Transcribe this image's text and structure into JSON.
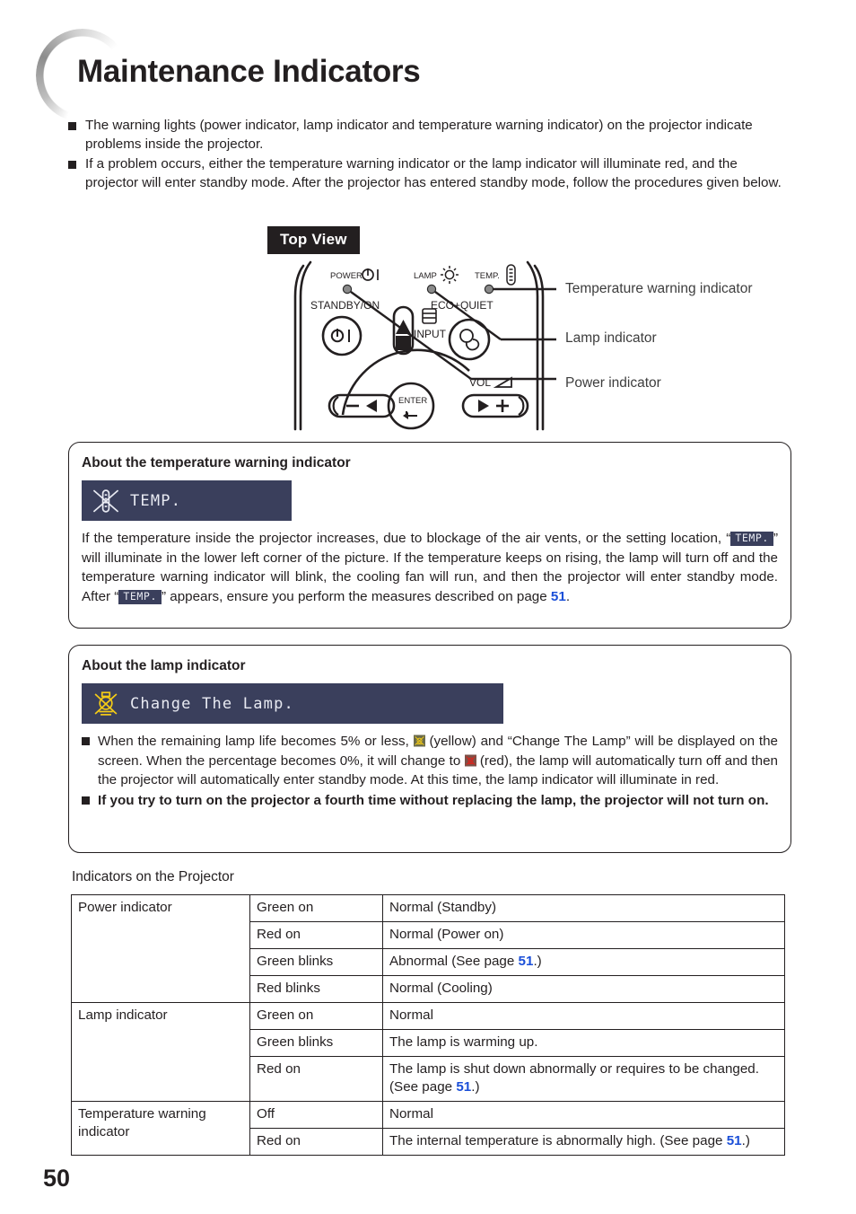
{
  "header": {
    "title": "Maintenance Indicators",
    "decoration_icon": "circle-ring-decoration"
  },
  "intro": {
    "bullets": [
      "The warning lights (power indicator, lamp indicator and temperature warning indicator) on the projector indicate problems inside the projector.",
      "If a problem occurs, either the temperature warning indicator or the lamp indicator will illuminate red, and the projector will enter standby mode. After the projector has entered standby mode, follow the procedures given below."
    ]
  },
  "diagram": {
    "label": "Top View",
    "control_labels": {
      "power": "POWER",
      "lamp": "LAMP",
      "temp": "TEMP.",
      "standby_on": "STANDBY/ON",
      "eco_quiet": "ECO+QUIET",
      "input": "INPUT",
      "vol": "VOL",
      "enter": "ENTER",
      "minus": "−",
      "plus": "+"
    },
    "callouts": [
      "Temperature warning indicator",
      "Lamp indicator",
      "Power indicator"
    ]
  },
  "temp_section": {
    "heading": "About the temperature warning indicator",
    "osd_label": "TEMP.",
    "osd_icon": "crossed-thermometer-icon",
    "osd_bg_color": "#3a3f5c",
    "body_part1": "If the temperature inside the projector increases, due to blockage of the air vents, or the setting location, “",
    "badge1": "TEMP.",
    "body_part2": "” will illuminate in the lower left corner of the picture. If the temperature keeps on rising, the lamp will turn off and the temperature warning indicator will blink, the cooling fan will run, and then the projector will enter standby mode. After “",
    "badge2": "TEMP.",
    "body_part3": "” appears, ensure you perform the measures described on page ",
    "page_ref": "51",
    "body_part4": "."
  },
  "lamp_section": {
    "heading": "About the lamp indicator",
    "osd_label": "Change The Lamp.",
    "osd_icon": "crossed-lamp-icon-yellow",
    "osd_bg_color": "#3a3f5c",
    "osd_icon_color": "#f5cc16",
    "bullet1_part1": "When the remaining lamp life becomes 5% or less, ",
    "bullet1_icon_yellow": "crossed-lamp-icon-yellow",
    "bullet1_part2": " (yellow) and “Change The Lamp” will be displayed on the screen. When the percentage becomes 0%, it will change to ",
    "bullet1_icon_red": "crossed-lamp-icon-red",
    "bullet1_part3": " (red), the lamp will automatically turn off and then the projector will automatically enter standby mode. At this time, the lamp indicator will illuminate in red.",
    "bullet2": "If you try to turn on the projector a fourth time without replacing the lamp, the projector will not turn on."
  },
  "table": {
    "caption": "Indicators on the Projector",
    "rows": [
      {
        "name": "Power indicator",
        "rowspan": 4,
        "state": "Green on",
        "desc_pre": "Normal (Standby)",
        "page_ref": "",
        "desc_post": ""
      },
      {
        "name": "",
        "rowspan": 0,
        "state": "Red on",
        "desc_pre": "Normal (Power on)",
        "page_ref": "",
        "desc_post": ""
      },
      {
        "name": "",
        "rowspan": 0,
        "state": "Green blinks",
        "desc_pre": "Abnormal (See page ",
        "page_ref": "51",
        "desc_post": ".)"
      },
      {
        "name": "",
        "rowspan": 0,
        "state": "Red blinks",
        "desc_pre": "Normal (Cooling)",
        "page_ref": "",
        "desc_post": ""
      },
      {
        "name": "Lamp indicator",
        "rowspan": 3,
        "state": "Green on",
        "desc_pre": "Normal",
        "page_ref": "",
        "desc_post": ""
      },
      {
        "name": "",
        "rowspan": 0,
        "state": "Green blinks",
        "desc_pre": "The lamp is warming up.",
        "page_ref": "",
        "desc_post": ""
      },
      {
        "name": "",
        "rowspan": 0,
        "state": "Red on",
        "desc_pre": "The lamp is shut down abnormally or requires to be changed. (See page ",
        "page_ref": "51",
        "desc_post": ".)"
      },
      {
        "name": "Temperature warning indicator",
        "rowspan": 2,
        "state": "Off",
        "desc_pre": "Normal",
        "page_ref": "",
        "desc_post": ""
      },
      {
        "name": "",
        "rowspan": 0,
        "state": "Red on",
        "desc_pre": "The internal temperature is abnormally high. (See page ",
        "page_ref": "51",
        "desc_post": ".)"
      }
    ]
  },
  "footer": {
    "page_number": "50"
  },
  "colors": {
    "text": "#231f20",
    "link_blue": "#1b4fd8",
    "osd_navy": "#3a3f5c",
    "lamp_yellow": "#f5cc16",
    "lamp_red": "#e32119"
  }
}
